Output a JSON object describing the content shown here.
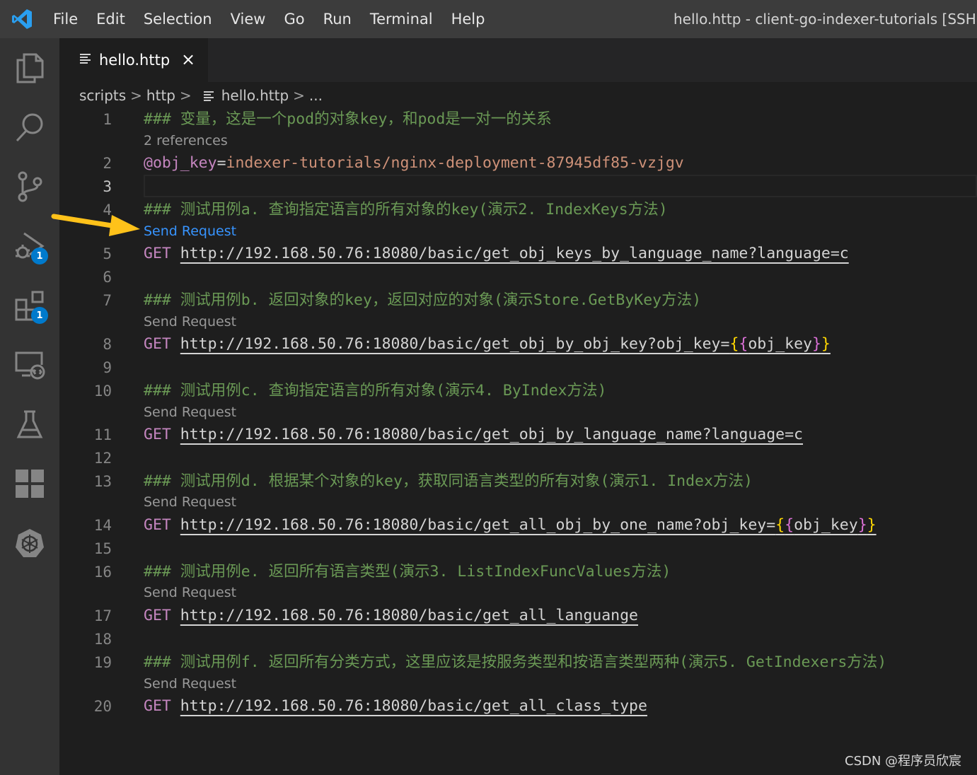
{
  "titlebar": {
    "menu": [
      "File",
      "Edit",
      "Selection",
      "View",
      "Go",
      "Run",
      "Terminal",
      "Help"
    ],
    "window_title": "hello.http - client-go-indexer-tutorials [SSH: he"
  },
  "activitybar": {
    "items": [
      {
        "name": "explorer-icon"
      },
      {
        "name": "search-icon"
      },
      {
        "name": "source-control-icon"
      },
      {
        "name": "run-debug-icon",
        "badge": "1"
      },
      {
        "name": "extensions-icon",
        "badge": "1"
      },
      {
        "name": "remote-explorer-icon"
      },
      {
        "name": "testing-icon"
      },
      {
        "name": "dashboard-icon"
      },
      {
        "name": "kubernetes-icon"
      }
    ]
  },
  "tab": {
    "label": "hello.http",
    "close": "×"
  },
  "breadcrumb": {
    "parts": [
      "scripts",
      "http",
      "hello.http",
      "..."
    ],
    "sep": ">"
  },
  "editor": {
    "references": "2 references",
    "send_request": "Send Request",
    "lines": [
      {
        "n": "1",
        "comment": "### 变量，这是一个pod的对象key，和pod是一对一的关系"
      },
      {
        "n": "2",
        "var": "@obj_key",
        "eq": "=",
        "value": "indexer-tutorials/nginx-deployment-87945df85-vzjgv"
      },
      {
        "n": "3"
      },
      {
        "n": "4",
        "comment": "### 测试用例a. 查询指定语言的所有对象的key(演示2. IndexKeys方法)"
      },
      {
        "n": "5",
        "method": "GET",
        "url": "http://192.168.50.76:18080/basic/get_obj_keys_by_language_name?language=c"
      },
      {
        "n": "6"
      },
      {
        "n": "7",
        "comment": "### 测试用例b. 返回对象的key，返回对应的对象(演示Store.GetByKey方法)"
      },
      {
        "n": "8",
        "method": "GET",
        "url": "http://192.168.50.76:18080/basic/get_obj_by_obj_key?obj_key=",
        "tpl": "obj_key"
      },
      {
        "n": "9"
      },
      {
        "n": "10",
        "comment": "### 测试用例c. 查询指定语言的所有对象(演示4. ByIndex方法)"
      },
      {
        "n": "11",
        "method": "GET",
        "url": "http://192.168.50.76:18080/basic/get_obj_by_language_name?language=c"
      },
      {
        "n": "12"
      },
      {
        "n": "13",
        "comment": "### 测试用例d. 根据某个对象的key，获取同语言类型的所有对象(演示1. Index方法)"
      },
      {
        "n": "14",
        "method": "GET",
        "url": "http://192.168.50.76:18080/basic/get_all_obj_by_one_name?obj_key=",
        "tpl": "obj_key"
      },
      {
        "n": "15"
      },
      {
        "n": "16",
        "comment": "### 测试用例e. 返回所有语言类型(演示3. ListIndexFuncValues方法)"
      },
      {
        "n": "17",
        "method": "GET",
        "url": "http://192.168.50.76:18080/basic/get_all_languange"
      },
      {
        "n": "18"
      },
      {
        "n": "19",
        "comment": "### 测试用例f. 返回所有分类方式，这里应该是按服务类型和按语言类型两种(演示5. GetIndexers方法)"
      },
      {
        "n": "20",
        "method": "GET",
        "url": "http://192.168.50.76:18080/basic/get_all_class_type"
      }
    ]
  },
  "watermark": "CSDN @程序员欣宸",
  "colors": {
    "accent": "#007acc",
    "arrow": "#ffc21a",
    "comment": "#6a9955",
    "link": "#3794ff"
  }
}
